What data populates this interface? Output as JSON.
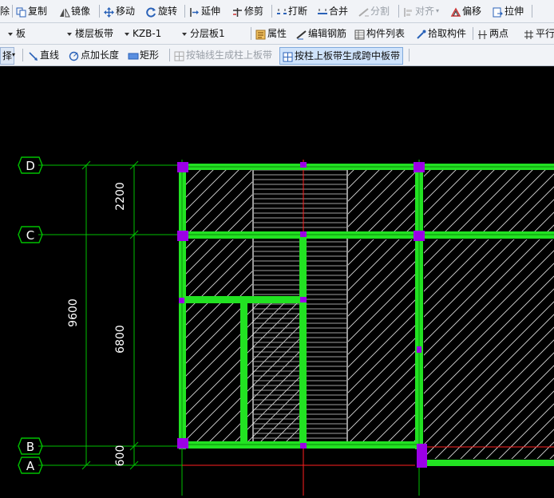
{
  "toolbar_row1": {
    "delete": "除",
    "copy": "复制",
    "mirror": "镜像",
    "move": "移动",
    "rotate": "旋转",
    "extend": "延伸",
    "trim": "修剪",
    "break": "打断",
    "merge": "合并",
    "split": "分割",
    "align": "对齐",
    "offset": "偏移",
    "stretch": "拉伸"
  },
  "toolbar_row2": {
    "type_select": "板",
    "category_select": "楼层板带",
    "name_select": "KZB-1",
    "layer_select": "分层板1",
    "properties": "属性",
    "edit_rebar": "编辑钢筋",
    "component_list": "构件列表",
    "pick_component": "拾取构件",
    "two_points": "两点",
    "parallel": "平行"
  },
  "toolbar_row3": {
    "select": "择",
    "line": "直线",
    "point_length": "点加长度",
    "rectangle": "矩形",
    "by_axis": "按轴线生成柱上板带",
    "by_column": "按柱上板带生成跨中板带"
  },
  "drawing": {
    "axes": [
      "D",
      "C",
      "B",
      "A"
    ],
    "dims_inner": [
      "2200",
      "6800",
      "600"
    ],
    "dim_total": "9600"
  },
  "colors": {
    "background": "#000000",
    "slab_band": "#22e222",
    "column": "#9b00e6",
    "axis_line": "#00c000",
    "red_line": "#ff2020",
    "hatch": "#d8d8d8",
    "dim_text": "#ffffff"
  }
}
